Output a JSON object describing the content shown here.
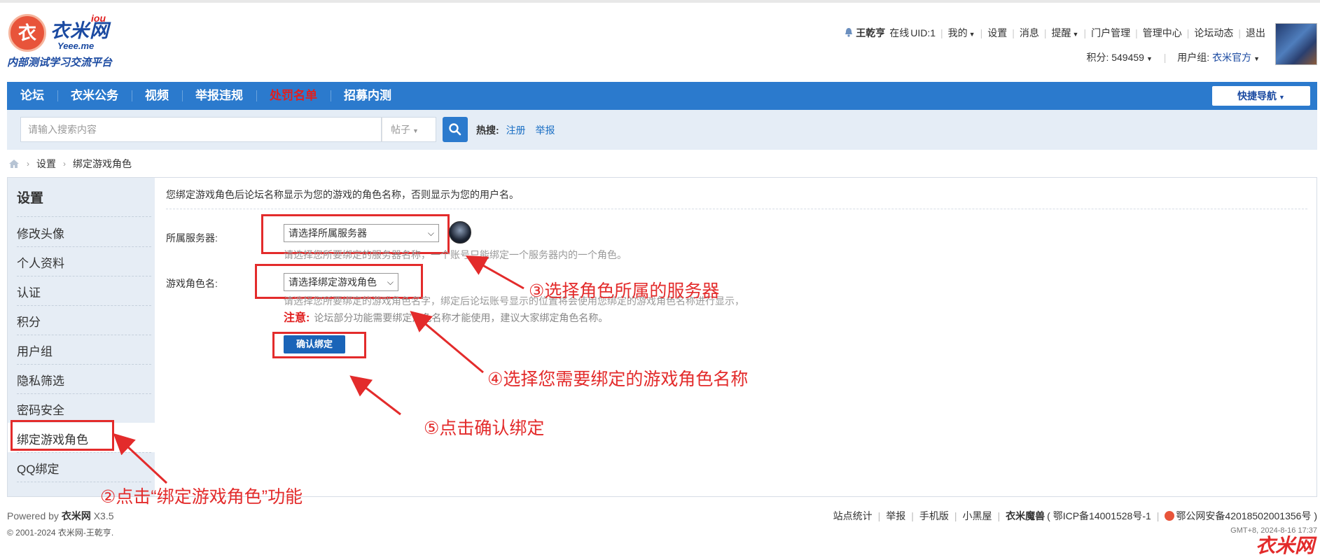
{
  "logo": {
    "mark": "衣",
    "name": "衣米网",
    "sup": "iou",
    "domain": "Yeee.me",
    "slogan": "内部测试学习交流平台"
  },
  "user": {
    "name": "王乾亨",
    "online": "在线",
    "uid": "UID:1",
    "menu": [
      "我的",
      "设置",
      "消息",
      "提醒",
      "门户管理",
      "管理中心",
      "论坛动态",
      "退出"
    ],
    "points": "积分: 549459",
    "group_label": "用户组:",
    "group": "衣米官方"
  },
  "nav": {
    "items": [
      "论坛",
      "衣米公务",
      "视频",
      "举报违规",
      "处罚名单",
      "招募内测"
    ],
    "quick": "快捷导航"
  },
  "search": {
    "placeholder": "请输入搜索内容",
    "type": "帖子",
    "hot_label": "热搜:",
    "hot": [
      "注册",
      "举报"
    ]
  },
  "breadcrumb": [
    "设置",
    "绑定游戏角色"
  ],
  "sidebar": {
    "title": "设置",
    "items": [
      "修改头像",
      "个人资料",
      "认证",
      "积分",
      "用户组",
      "隐私筛选",
      "密码安全",
      "绑定游戏角色",
      "QQ绑定"
    ]
  },
  "form": {
    "description": "您绑定游戏角色后论坛名称显示为您的游戏的角色名称，否则显示为您的用户名。",
    "server_label": "所属服务器:",
    "server_select": "请选择所属服务器",
    "server_hint": "请选择您所要绑定的服务器名称，一个账号只能绑定一个服务器内的一个角色。",
    "role_label": "游戏角色名:",
    "role_select": "请选择绑定游戏角色",
    "role_hint": "请选择您所要绑定的游戏角色名字，绑定后论坛账号显示的位置将会使用您绑定的游戏角色名称进行显示，",
    "note_label": "注意:",
    "note_text": "论坛部分功能需要绑定角色名称才能使用，建议大家绑定角色名称。",
    "confirm": "确认绑定"
  },
  "annotations": {
    "step2": "②点击“绑定游戏角色”功能",
    "step3": "③选择角色所属的服务器",
    "step4": "④选择您需要绑定的游戏角色名称",
    "step5": "⑤点击确认绑定"
  },
  "footer": {
    "powered_prefix": "Powered by",
    "powered_name": "衣米网",
    "powered_version": "X3.5",
    "copyright": "© 2001-2024 衣米网-王乾亨.",
    "links": [
      "站点统计",
      "举报",
      "手机版",
      "小黑屋"
    ],
    "site": "衣米魔兽",
    "icp": "( 鄂ICP备14001528号-1",
    "police": "鄂公网安备42018502001356号 )",
    "time": "GMT+8, 2024-8-16 17:37",
    "watermark": "衣米网"
  },
  "colors": {
    "nav": "#2b7acd",
    "annotation": "#e32b2b",
    "brand": "#1b4aa1"
  }
}
